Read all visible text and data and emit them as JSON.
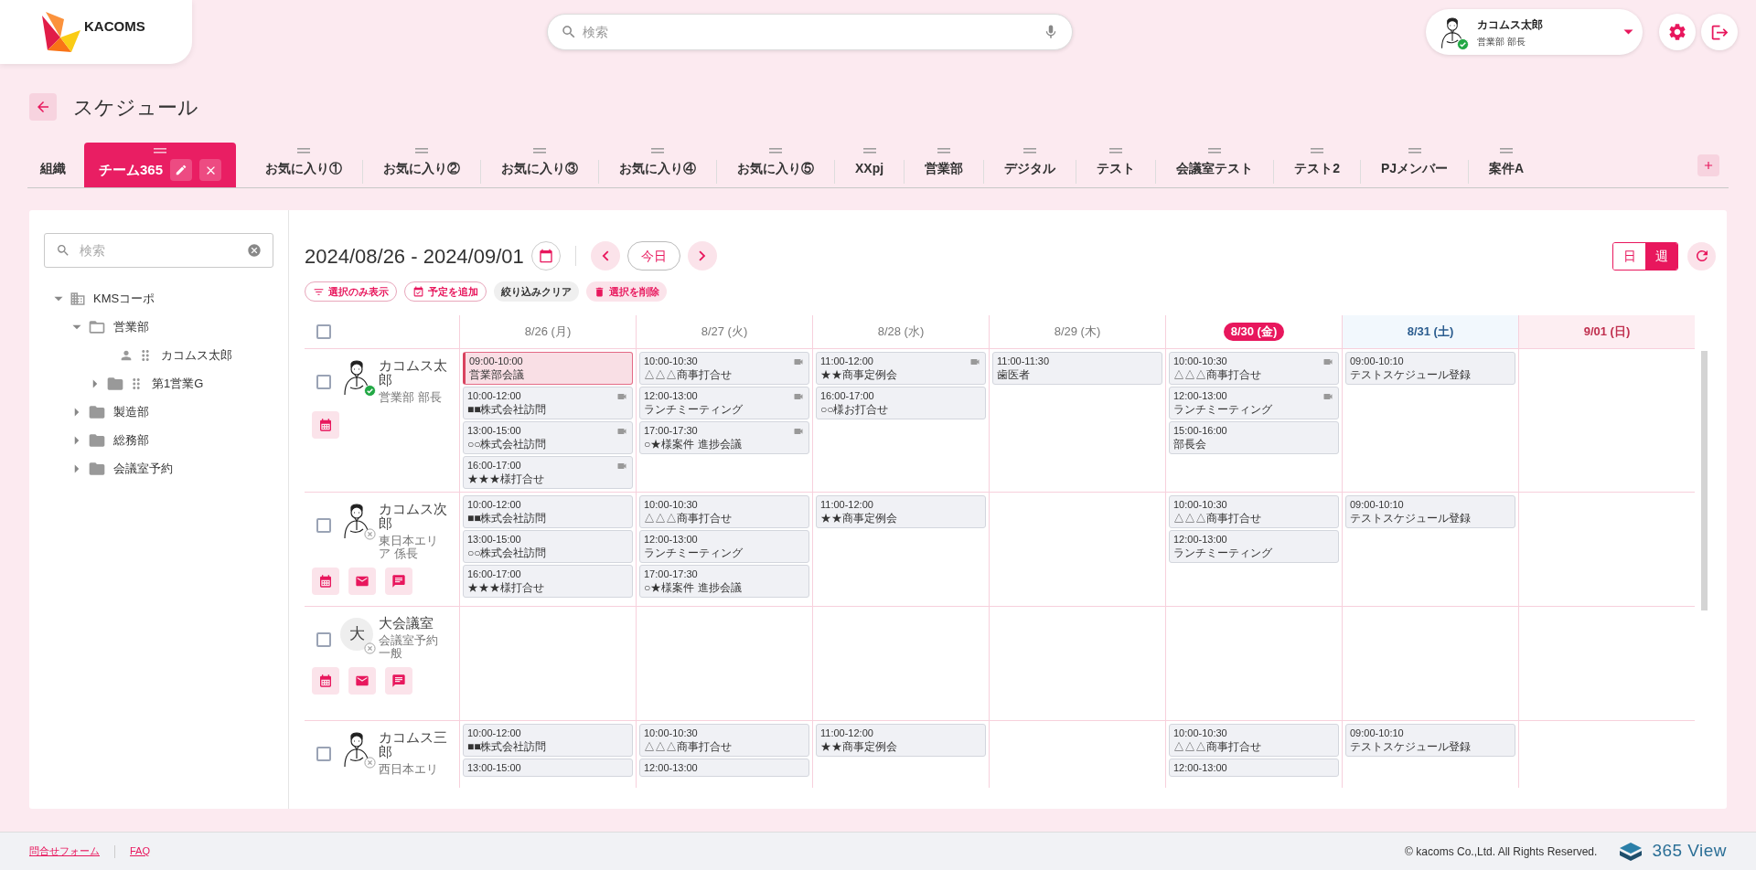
{
  "header": {
    "logo_text": "KACOMS",
    "search": {
      "placeholder": "検索"
    },
    "user": {
      "name": "カコムス太郎",
      "role": "営業部 部長",
      "online": true
    }
  },
  "page_title": "スケジュール",
  "tabs": [
    {
      "label": "組織",
      "selected": false,
      "draggable": false
    },
    {
      "label": "チーム365",
      "selected": true,
      "draggable": true
    },
    {
      "label": "お気に入り①",
      "selected": false,
      "draggable": true
    },
    {
      "label": "お気に入り②",
      "selected": false,
      "draggable": true
    },
    {
      "label": "お気に入り③",
      "selected": false,
      "draggable": true
    },
    {
      "label": "お気に入り④",
      "selected": false,
      "draggable": true
    },
    {
      "label": "お気に入り⑤",
      "selected": false,
      "draggable": true
    },
    {
      "label": "XXpj",
      "selected": false,
      "draggable": true
    },
    {
      "label": "営業部",
      "selected": false,
      "draggable": true
    },
    {
      "label": "デジタル",
      "selected": false,
      "draggable": true
    },
    {
      "label": "テスト",
      "selected": false,
      "draggable": true
    },
    {
      "label": "会議室テスト",
      "selected": false,
      "draggable": true
    },
    {
      "label": "テスト2",
      "selected": false,
      "draggable": true
    },
    {
      "label": "PJメンバー",
      "selected": false,
      "draggable": true
    },
    {
      "label": "案件A",
      "selected": false,
      "draggable": true
    }
  ],
  "sidebar": {
    "search": {
      "placeholder": "検索"
    },
    "tree": [
      {
        "label": "KMSコーポ",
        "kind": "org",
        "expanded": true,
        "children": [
          {
            "label": "営業部",
            "kind": "folder",
            "expanded": true,
            "children": [
              {
                "label": "カコムス太郎",
                "kind": "person"
              },
              {
                "label": "第1営業G",
                "kind": "group",
                "expanded": false
              }
            ]
          },
          {
            "label": "製造部",
            "kind": "folder",
            "expanded": false
          },
          {
            "label": "総務部",
            "kind": "folder",
            "expanded": false
          },
          {
            "label": "会議室予約",
            "kind": "folder",
            "expanded": false
          }
        ]
      }
    ]
  },
  "calendar": {
    "range": "2024/08/26 - 2024/09/01",
    "today_button": "今日",
    "views": [
      {
        "label": "日",
        "selected": false
      },
      {
        "label": "週",
        "selected": true
      }
    ],
    "actions": [
      {
        "label": "選択のみ表示",
        "kind": "filter"
      },
      {
        "label": "予定を追加",
        "kind": "add"
      },
      {
        "label": "絞り込みクリア",
        "kind": "clear"
      },
      {
        "label": "選択を削除",
        "kind": "delete"
      }
    ],
    "select_all_checked": false,
    "days": [
      {
        "label": "8/26 (月)",
        "kind": "weekday"
      },
      {
        "label": "8/27 (火)",
        "kind": "weekday"
      },
      {
        "label": "8/28 (水)",
        "kind": "weekday"
      },
      {
        "label": "8/29 (木)",
        "kind": "weekday"
      },
      {
        "label": "8/30 (金)",
        "kind": "today"
      },
      {
        "label": "8/31 (土)",
        "kind": "saturday"
      },
      {
        "label": "9/01 (日)",
        "kind": "sunday"
      }
    ],
    "rows": [
      {
        "name": "カコムス太郎",
        "dept": "営業部 部長",
        "kind": "person",
        "online": true,
        "checked": false,
        "buttons": [
          {
            "kind": "calendar"
          }
        ],
        "schedule": {
          "mon": [
            {
              "time": "09:00-10:00",
              "title": "営業部会議",
              "video": false,
              "selected": true
            },
            {
              "time": "10:00-12:00",
              "title": "■■株式会社訪問",
              "video": true,
              "selected": false
            },
            {
              "time": "13:00-15:00",
              "title": "○○株式会社訪問",
              "video": true,
              "selected": false
            },
            {
              "time": "16:00-17:00",
              "title": "★★★様打合せ",
              "video": true,
              "selected": false
            }
          ],
          "tue": [
            {
              "time": "10:00-10:30",
              "title": "△△△商事打合せ",
              "video": true,
              "selected": false
            },
            {
              "time": "12:00-13:00",
              "title": "ランチミーティング",
              "video": true,
              "selected": false
            },
            {
              "time": "17:00-17:30",
              "title": "○★様案件 進捗会議",
              "video": true,
              "selected": false
            }
          ],
          "wed": [
            {
              "time": "11:00-12:00",
              "title": "★★商事定例会",
              "video": true,
              "selected": false
            },
            {
              "time": "16:00-17:00",
              "title": "○○様お打合せ",
              "video": false,
              "selected": false
            }
          ],
          "thu": [
            {
              "time": "11:00-11:30",
              "title": "歯医者",
              "video": false,
              "selected": false
            }
          ],
          "fri": [
            {
              "time": "10:00-10:30",
              "title": "△△△商事打合せ",
              "video": true,
              "selected": false
            },
            {
              "time": "12:00-13:00",
              "title": "ランチミーティング",
              "video": true,
              "selected": false
            },
            {
              "time": "15:00-16:00",
              "title": "部長会",
              "video": false,
              "selected": false
            }
          ],
          "sat": [
            {
              "time": "09:00-10:10",
              "title": "テストスケジュール登録",
              "video": false,
              "selected": false
            }
          ]
        }
      },
      {
        "name": "カコムス次郎",
        "dept": "東日本エリア 係長",
        "kind": "person",
        "online": false,
        "checked": false,
        "buttons": [
          {
            "kind": "calendar"
          },
          {
            "kind": "mail"
          },
          {
            "kind": "chat"
          }
        ],
        "schedule": {
          "mon": [
            {
              "time": "10:00-12:00",
              "title": "■■株式会社訪問",
              "video": false,
              "selected": false
            },
            {
              "time": "13:00-15:00",
              "title": "○○株式会社訪問",
              "video": false,
              "selected": false
            },
            {
              "time": "16:00-17:00",
              "title": "★★★様打合せ",
              "video": false,
              "selected": false
            }
          ],
          "tue": [
            {
              "time": "10:00-10:30",
              "title": "△△△商事打合せ",
              "video": false,
              "selected": false
            },
            {
              "time": "12:00-13:00",
              "title": "ランチミーティング",
              "video": false,
              "selected": false
            },
            {
              "time": "17:00-17:30",
              "title": "○★様案件 進捗会議",
              "video": false,
              "selected": false
            }
          ],
          "wed": [
            {
              "time": "11:00-12:00",
              "title": "★★商事定例会",
              "video": false,
              "selected": false
            }
          ],
          "fri": [
            {
              "time": "10:00-10:30",
              "title": "△△△商事打合せ",
              "video": false,
              "selected": false
            },
            {
              "time": "12:00-13:00",
              "title": "ランチミーティング",
              "video": false,
              "selected": false
            }
          ],
          "sat": [
            {
              "time": "09:00-10:10",
              "title": "テストスケジュール登録",
              "video": false,
              "selected": false
            }
          ]
        }
      },
      {
        "name": "大会議室",
        "dept": "会議室予約一般",
        "kind": "room",
        "initial": "大",
        "online": false,
        "checked": false,
        "buttons": [
          {
            "kind": "calendar"
          },
          {
            "kind": "mail"
          },
          {
            "kind": "chat"
          }
        ]
      },
      {
        "name": "カコムス三郎",
        "dept": "西日本エリ",
        "kind": "person",
        "online": false,
        "checked": false,
        "schedule": {
          "mon": [
            {
              "time": "10:00-12:00",
              "title": "■■株式会社訪問",
              "video": false,
              "selected": false
            },
            {
              "time": "13:00-15:00",
              "video": false,
              "selected": false
            }
          ],
          "tue": [
            {
              "time": "10:00-10:30",
              "title": "△△△商事打合せ",
              "video": false,
              "selected": false
            },
            {
              "time": "12:00-13:00",
              "video": false,
              "selected": false
            }
          ],
          "wed": [
            {
              "time": "11:00-12:00",
              "title": "★★商事定例会",
              "video": false,
              "selected": false
            }
          ],
          "fri": [
            {
              "time": "10:00-10:30",
              "title": "△△△商事打合せ",
              "video": false,
              "selected": false
            },
            {
              "time": "12:00-13:00",
              "video": false,
              "selected": false
            }
          ],
          "sat": [
            {
              "time": "09:00-10:10",
              "title": "テストスケジュール登録",
              "video": false,
              "selected": false
            }
          ]
        }
      }
    ]
  },
  "footer": {
    "links": [
      "問合せフォーム",
      "FAQ"
    ],
    "copyright": "© kacoms Co.,Ltd. All Rights Reserved.",
    "product": "365 View"
  }
}
